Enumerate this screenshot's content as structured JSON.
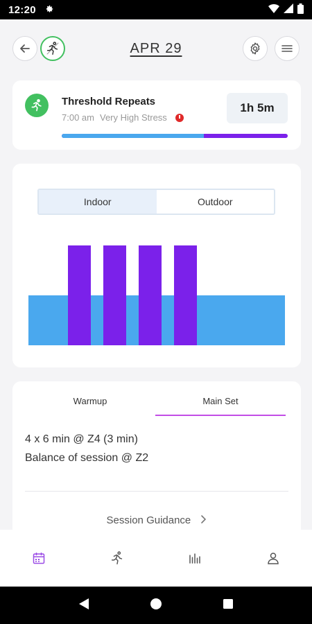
{
  "status_bar": {
    "time": "12:20",
    "settings_icon": "gear-icon",
    "wifi_icon": "wifi-icon",
    "signal_icon": "signal-icon",
    "battery_icon": "battery-icon"
  },
  "header": {
    "date": "APR 29",
    "back_icon": "arrow-left-icon",
    "activity_icon": "runner-icon",
    "settings_icon": "gear-icon",
    "menu_icon": "menu-icon"
  },
  "workout": {
    "title": "Threshold Repeats",
    "time": "7:00 am",
    "stress": "Very High Stress",
    "duration": "1h 5m",
    "progress_fraction": 0.63,
    "colors": {
      "progress_done": "#4aa8ee",
      "progress_remaining": "#7b21ea",
      "icon_bg": "#42c060",
      "stress": "#e02a2a"
    }
  },
  "chart": {
    "toggle": {
      "indoor": "Indoor",
      "outdoor": "Outdoor",
      "selected": "Indoor"
    },
    "intervals": {
      "repeats": 4,
      "base_zone": 2,
      "interval_zone": 4
    },
    "colors": {
      "base": "#4aa8ee",
      "interval": "#7b21ea"
    }
  },
  "session": {
    "tabs": {
      "warmup": "Warmup",
      "main_set": "Main Set",
      "selected": "Main Set"
    },
    "line1": "4 x 6 min @ Z4 (3 min)",
    "line2": "Balance of session @ Z2",
    "guidance": "Session Guidance"
  },
  "bottom_nav": [
    {
      "name": "calendar-icon",
      "active": true
    },
    {
      "name": "runner-icon",
      "active": false
    },
    {
      "name": "bar-chart-icon",
      "active": false
    },
    {
      "name": "person-icon",
      "active": false
    }
  ],
  "accent_color": "#9b4ce6"
}
